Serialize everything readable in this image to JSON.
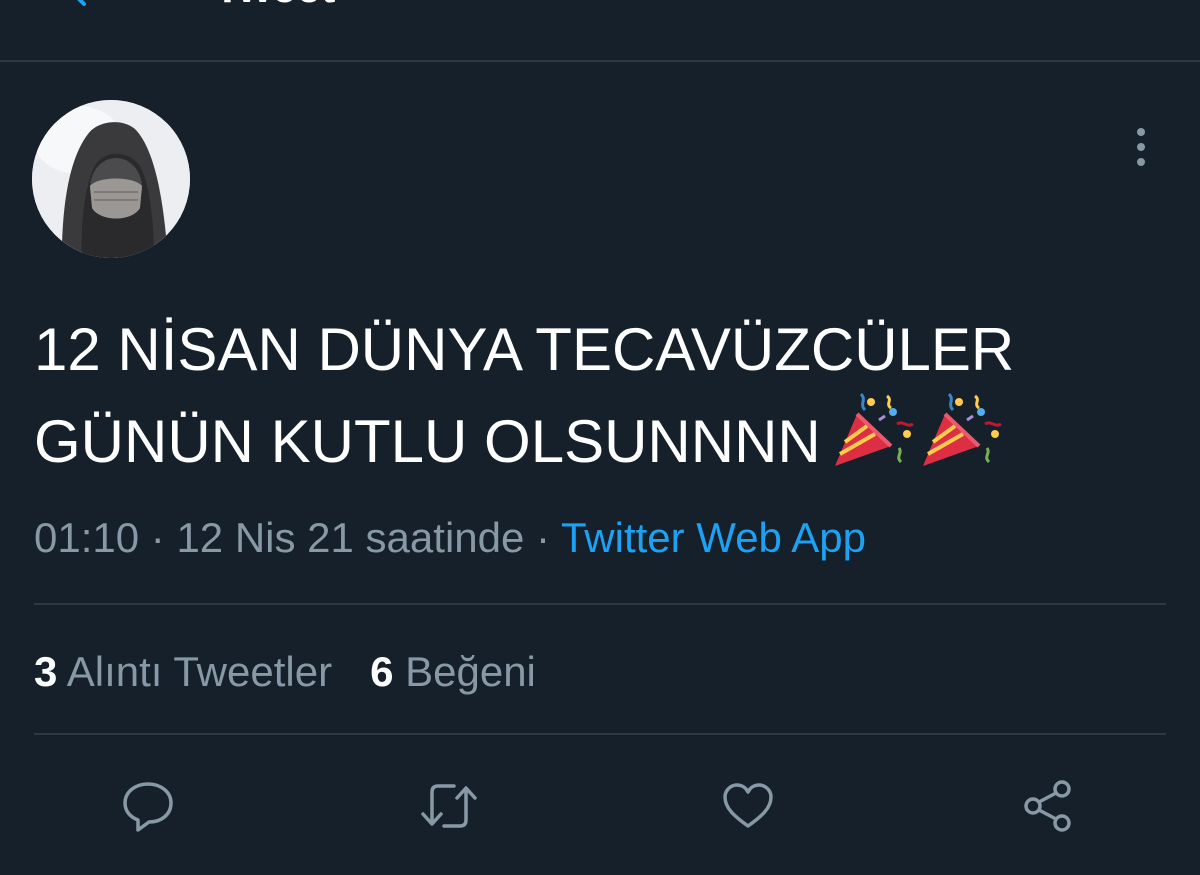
{
  "header": {
    "title": "Tweet",
    "back_icon": "arrow-left-icon"
  },
  "tweet": {
    "avatar_icon": "avatar-image",
    "more_icon": "more-vertical-icon",
    "text_line1": "12 NİSAN DÜNYA TECAVÜZCÜLER",
    "text_line2": "GÜNÜN KUTLU OLSUNNNN",
    "emojis": [
      "party-popper-icon",
      "party-popper-icon"
    ],
    "time": "01:10",
    "separator": "·",
    "date": "12 Nis 21 saatinde",
    "source": "Twitter Web App"
  },
  "stats": {
    "quote_count": "3",
    "quote_label": "Alıntı Tweetler",
    "like_count": "6",
    "like_label": "Beğeni"
  },
  "actions": {
    "reply_icon": "reply-icon",
    "retweet_icon": "retweet-icon",
    "like_icon": "heart-icon",
    "share_icon": "share-icon"
  },
  "colors": {
    "background": "#15202b",
    "divider": "#2b3945",
    "secondary_text": "#8899a6",
    "link": "#1da1f2",
    "icon": "#8899a6"
  }
}
